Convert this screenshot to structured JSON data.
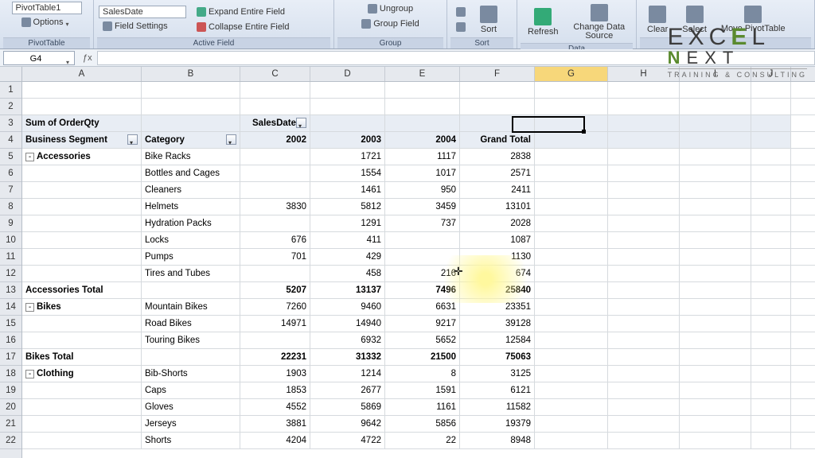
{
  "ribbon": {
    "pivot_name": "PivotTable1",
    "options": "Options",
    "group_labels": {
      "pivot": "PivotTable",
      "active": "Active Field",
      "group": "Group",
      "sort": "Sort",
      "data": "Data"
    },
    "active_field_value": "SalesDate",
    "field_settings": "Field Settings",
    "expand": "Expand Entire Field",
    "collapse": "Collapse Entire Field",
    "ungroup": "Ungroup",
    "group_field": "Group Field",
    "sort": "Sort",
    "refresh": "Refresh",
    "change_ds": "Change Data Source",
    "clear": "Clear",
    "select": "Select",
    "move": "Move PivotTable"
  },
  "namebox": "G4",
  "watermark": {
    "l1a": "EXC",
    "l1b": "E",
    "l1c": "L",
    "l2": "NEXT",
    "tag": "TRAINING & CONSULTING"
  },
  "cols": [
    "A",
    "B",
    "C",
    "D",
    "E",
    "F",
    "G",
    "H",
    "I",
    "J"
  ],
  "col_widths": [
    "wA",
    "wB",
    "wC",
    "wD",
    "wE",
    "wF",
    "wG",
    "wH",
    "wI",
    "wJ"
  ],
  "active_col_index": 6,
  "active_cell": {
    "col": 6,
    "row": 3
  },
  "row_count": 22,
  "pivot": {
    "measure": "Sum of OrderQty",
    "col_field": "SalesDate",
    "row_field1": "Business Segment",
    "row_field2": "Category",
    "years": [
      "2002",
      "2003",
      "2004"
    ],
    "grand_total": "Grand Total",
    "rows": [
      {
        "r": 5,
        "seg": "Accessories",
        "exp": "-",
        "cat": "Bike Racks",
        "y02": "",
        "y03": "1721",
        "y04": "1117",
        "gt": "2838"
      },
      {
        "r": 6,
        "cat": "Bottles and Cages",
        "y02": "",
        "y03": "1554",
        "y04": "1017",
        "gt": "2571"
      },
      {
        "r": 7,
        "cat": "Cleaners",
        "y02": "",
        "y03": "1461",
        "y04": "950",
        "gt": "2411"
      },
      {
        "r": 8,
        "cat": "Helmets",
        "y02": "3830",
        "y03": "5812",
        "y04": "3459",
        "gt": "13101"
      },
      {
        "r": 9,
        "cat": "Hydration Packs",
        "y02": "",
        "y03": "1291",
        "y04": "737",
        "gt": "2028"
      },
      {
        "r": 10,
        "cat": "Locks",
        "y02": "676",
        "y03": "411",
        "y04": "",
        "gt": "1087"
      },
      {
        "r": 11,
        "cat": "Pumps",
        "y02": "701",
        "y03": "429",
        "y04": "",
        "gt": "1130"
      },
      {
        "r": 12,
        "cat": "Tires and Tubes",
        "y02": "",
        "y03": "458",
        "y04": "216",
        "gt": "674"
      },
      {
        "r": 13,
        "total": "Accessories Total",
        "y02": "5207",
        "y03": "13137",
        "y04": "7496",
        "gt": "25840"
      },
      {
        "r": 14,
        "seg": "Bikes",
        "exp": "-",
        "cat": "Mountain Bikes",
        "y02": "7260",
        "y03": "9460",
        "y04": "6631",
        "gt": "23351"
      },
      {
        "r": 15,
        "cat": "Road Bikes",
        "y02": "14971",
        "y03": "14940",
        "y04": "9217",
        "gt": "39128"
      },
      {
        "r": 16,
        "cat": "Touring Bikes",
        "y02": "",
        "y03": "6932",
        "y04": "5652",
        "gt": "12584"
      },
      {
        "r": 17,
        "total": "Bikes Total",
        "y02": "22231",
        "y03": "31332",
        "y04": "21500",
        "gt": "75063"
      },
      {
        "r": 18,
        "seg": "Clothing",
        "exp": "-",
        "cat": "Bib-Shorts",
        "y02": "1903",
        "y03": "1214",
        "y04": "8",
        "gt": "3125"
      },
      {
        "r": 19,
        "cat": "Caps",
        "y02": "1853",
        "y03": "2677",
        "y04": "1591",
        "gt": "6121"
      },
      {
        "r": 20,
        "cat": "Gloves",
        "y02": "4552",
        "y03": "5869",
        "y04": "1161",
        "gt": "11582"
      },
      {
        "r": 21,
        "cat": "Jerseys",
        "y02": "3881",
        "y03": "9642",
        "y04": "5856",
        "gt": "19379"
      },
      {
        "r": 22,
        "cat": "Shorts",
        "y02": "4204",
        "y03": "4722",
        "y04": "22",
        "gt": "8948"
      }
    ]
  }
}
